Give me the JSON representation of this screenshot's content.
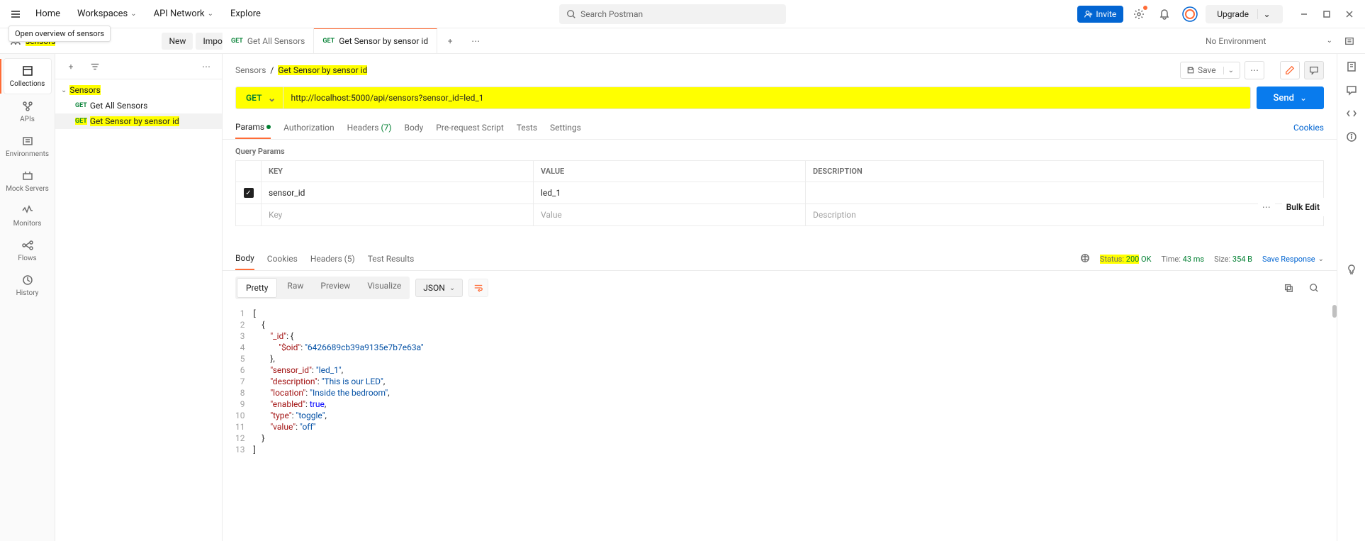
{
  "tooltip": "Open overview of sensors",
  "topbar": {
    "home": "Home",
    "workspaces": "Workspaces",
    "api_network": "API Network",
    "explore": "Explore",
    "search_placeholder": "Search Postman",
    "invite": "Invite",
    "upgrade": "Upgrade"
  },
  "workspace": {
    "name": "sensors",
    "new": "New",
    "import": "Import",
    "environment": "No Environment"
  },
  "leftrail": {
    "collections": "Collections",
    "apis": "APIs",
    "environments": "Environments",
    "mock": "Mock Servers",
    "monitors": "Monitors",
    "flows": "Flows",
    "history": "History"
  },
  "tree": {
    "collection": "Sensors",
    "item1_method": "GET",
    "item1": "Get All Sensors",
    "item2_method": "GET",
    "item2": "Get Sensor by sensor id"
  },
  "tabs": {
    "t1_method": "GET",
    "t1": "Get All Sensors",
    "t2_method": "GET",
    "t2": "Get Sensor by sensor id"
  },
  "breadcrumb": {
    "root": "Sensors",
    "current": "Get Sensor by sensor id",
    "save": "Save"
  },
  "request": {
    "method": "GET",
    "url": "http://localhost:5000/api/sensors?sensor_id=led_1",
    "send": "Send"
  },
  "req_tabs": {
    "params": "Params",
    "auth": "Authorization",
    "headers": "Headers",
    "headers_count": "(7)",
    "body": "Body",
    "prereq": "Pre-request Script",
    "tests": "Tests",
    "settings": "Settings",
    "cookies": "Cookies"
  },
  "params": {
    "title": "Query Params",
    "h_key": "KEY",
    "h_value": "VALUE",
    "h_desc": "DESCRIPTION",
    "bulk": "Bulk Edit",
    "row_key": "sensor_id",
    "row_value": "led_1",
    "ph_key": "Key",
    "ph_value": "Value",
    "ph_desc": "Description"
  },
  "resp_tabs": {
    "body": "Body",
    "cookies": "Cookies",
    "headers": "Headers",
    "headers_count": "(5)",
    "tests": "Test Results"
  },
  "resp_status": {
    "status_label": "Status:",
    "status_code": "200",
    "status_text": "OK",
    "time_label": "Time:",
    "time_value": "43 ms",
    "size_label": "Size:",
    "size_value": "354 B",
    "save": "Save Response"
  },
  "resp_toolbar": {
    "pretty": "Pretty",
    "raw": "Raw",
    "preview": "Preview",
    "visualize": "Visualize",
    "format": "JSON"
  },
  "json": {
    "l1": "[",
    "l2": "    {",
    "l3a": "        \"_id\"",
    "l3b": ": {",
    "l4a": "            \"$oid\"",
    "l4b": ": ",
    "l4c": "\"6426689cb39a9135e7b7e63a\"",
    "l5": "        },",
    "l6a": "        \"sensor_id\"",
    "l6b": ": ",
    "l6c": "\"led_1\"",
    "l6d": ",",
    "l7a": "        \"description\"",
    "l7b": ": ",
    "l7c": "\"This is our LED\"",
    "l7d": ",",
    "l8a": "        \"location\"",
    "l8b": ": ",
    "l8c": "\"Inside the bedroom\"",
    "l8d": ",",
    "l9a": "        \"enabled\"",
    "l9b": ": ",
    "l9c": "true",
    "l9d": ",",
    "l10a": "        \"type\"",
    "l10b": ": ",
    "l10c": "\"toggle\"",
    "l10d": ",",
    "l11a": "        \"value\"",
    "l11b": ": ",
    "l11c": "\"off\"",
    "l12": "    }",
    "l13": "]"
  }
}
